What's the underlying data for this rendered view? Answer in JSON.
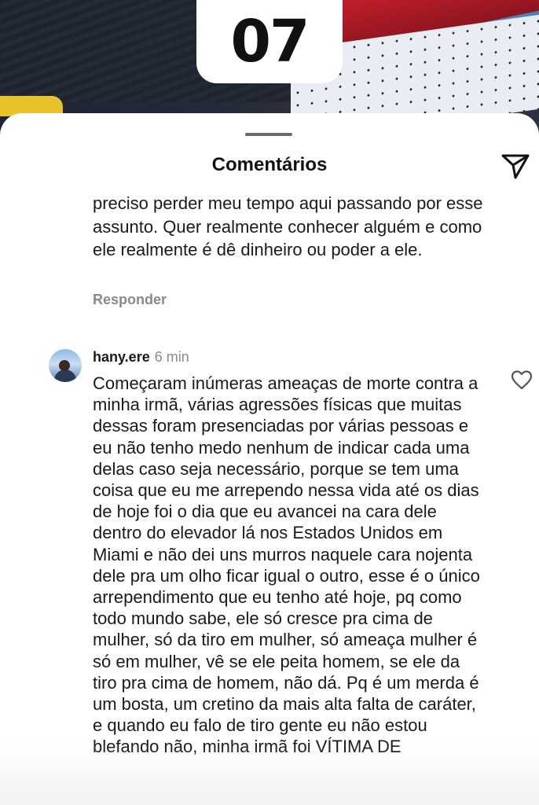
{
  "story": {
    "number_badge": "07"
  },
  "comments_sheet": {
    "title": "Comentários",
    "icons": {
      "share": "paper-plane-icon",
      "like": "heart-icon"
    },
    "previous_comment": {
      "text": "preciso perder meu tempo aqui passando por esse assunto. Quer realmente conhecer alguém e como ele realmente é dê dinheiro ou poder a ele.",
      "reply_label": "Responder"
    },
    "comment": {
      "username": "hany.ere",
      "time": "6 min",
      "text": "Começaram inúmeras ameaças de morte contra a minha irmã, várias agressões físicas que muitas dessas foram presenciadas por várias pessoas e eu não tenho medo nenhum de indicar cada uma delas caso seja necessário, porque se tem uma coisa que eu me arrependo nessa vida até os dias de hoje foi o dia que eu avancei na cara dele dentro do elevador lá nos Estados Unidos em Miami e não dei uns murros naquele cara nojenta dele pra um olho ficar igual o outro, esse é o único arrependimento que eu tenho até hoje, pq como todo mundo sabe, ele só cresce pra cima de mulher, só da tiro em mulher, só ameaça mulher é só em mulher, vê se ele peita homem, se ele da tiro pra cima de homem, não dá. Pq é um merda é um bosta, um cretino da mais alta falta de caráter, e quando eu falo de tiro gente eu não estou blefando não, minha irmã foi VÍTIMA DE"
    }
  }
}
